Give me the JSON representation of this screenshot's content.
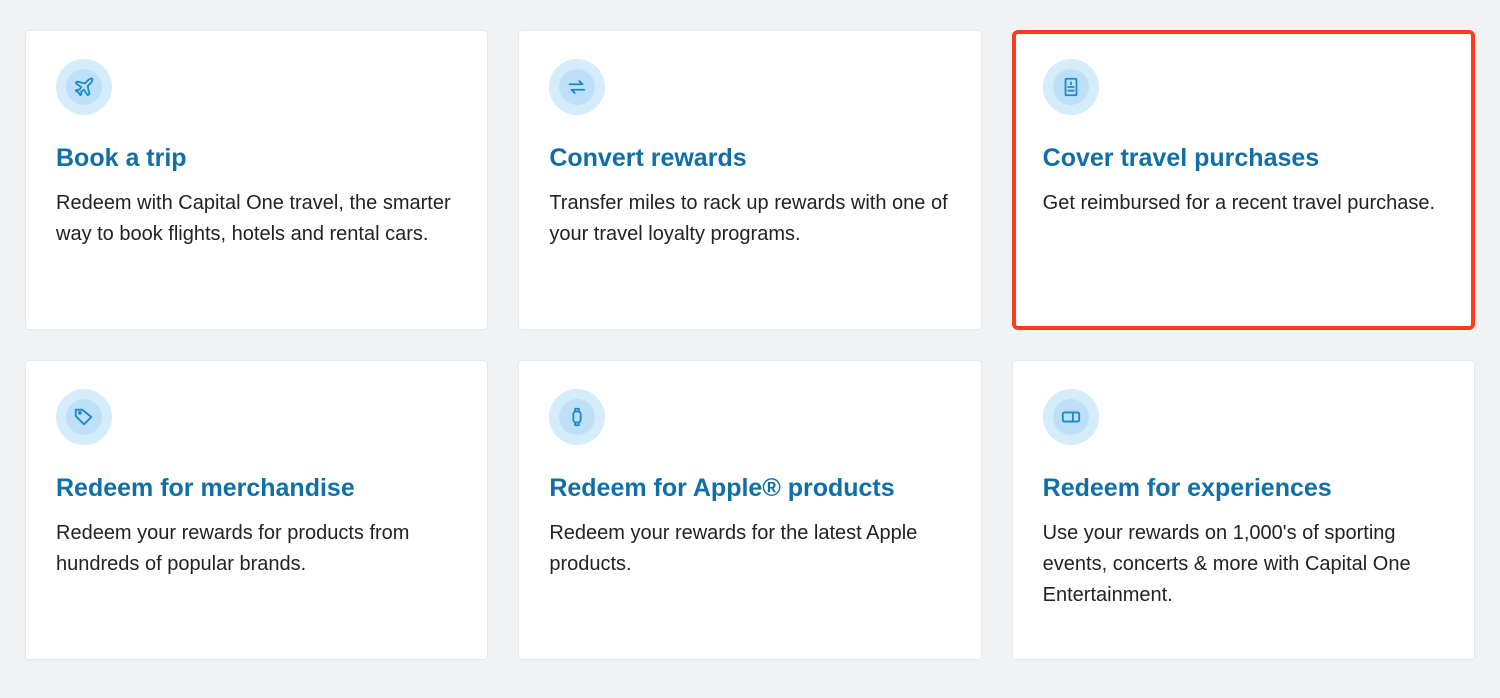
{
  "cards": [
    {
      "icon": "airplane",
      "title": "Book a trip",
      "desc": "Redeem with Capital One travel, the smarter way to book flights, hotels and rental cars.",
      "highlighted": false
    },
    {
      "icon": "swap",
      "title": "Convert rewards",
      "desc": "Transfer miles to rack up rewards with one of your travel loyalty programs.",
      "highlighted": false
    },
    {
      "icon": "receipt",
      "title": "Cover travel purchases",
      "desc": "Get reimbursed for a recent travel purchase.",
      "highlighted": true
    },
    {
      "icon": "tag",
      "title": "Redeem for merchandise",
      "desc": "Redeem your rewards for products from hundreds of popular brands.",
      "highlighted": false
    },
    {
      "icon": "watch",
      "title": "Redeem for Apple® products",
      "desc": "Redeem your rewards for the latest Apple products.",
      "highlighted": false
    },
    {
      "icon": "ticket",
      "title": "Redeem for experiences",
      "desc": "Use your rewards on 1,000's of sporting events, concerts & more with Capital One Entertainment.",
      "highlighted": false
    }
  ],
  "colors": {
    "accent": "#0f6fa6",
    "highlight": "#ff3b1f",
    "iconBg": "#d5ecfb",
    "iconFg": "#1d8ac7"
  }
}
